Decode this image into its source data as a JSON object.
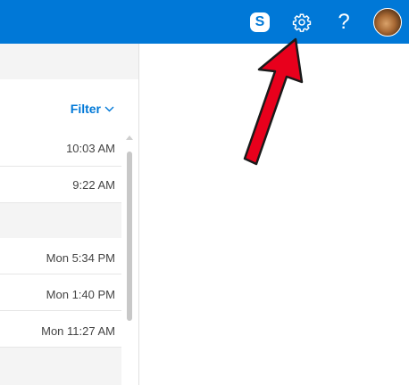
{
  "topbar": {
    "skype_glyph": "S",
    "icons": [
      "skype-icon",
      "gear-icon",
      "help-icon",
      "avatar"
    ],
    "help_glyph": "?"
  },
  "message_list": {
    "filter_label": "Filter",
    "rows": [
      {
        "time": "10:03 AM"
      },
      {
        "time": "9:22 AM"
      },
      {
        "time": "Mon 5:34 PM"
      },
      {
        "time": "Mon 1:40 PM"
      },
      {
        "time": "Mon 11:27 AM"
      }
    ]
  },
  "colors": {
    "topbar": "#0078d7",
    "accent": "#0078d7",
    "annotation_arrow": "#e8001c"
  }
}
